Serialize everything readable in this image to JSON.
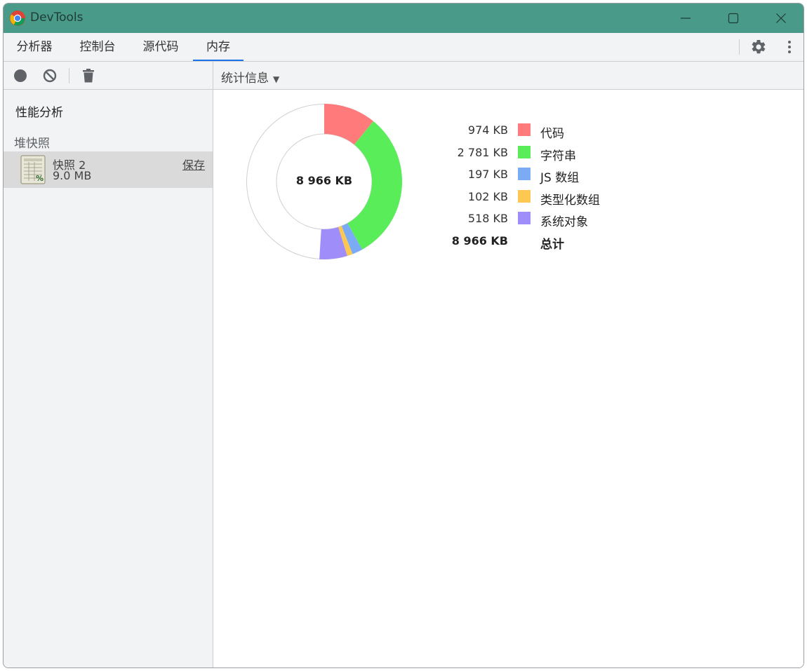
{
  "window": {
    "title": "DevTools"
  },
  "tabs": [
    {
      "label": "分析器"
    },
    {
      "label": "控制台"
    },
    {
      "label": "源代码"
    },
    {
      "label": "内存"
    }
  ],
  "sidebar": {
    "section_title": "性能分析",
    "group_title": "堆快照",
    "snapshot": {
      "name": "快照 2",
      "size": "9.0 MB",
      "save_label": "保存"
    }
  },
  "main": {
    "view_select": "统计信息",
    "center_total": "8 966 KB"
  },
  "colors": {
    "accent": "#1a73e8",
    "titlebar": "#4a9a89",
    "code": "#ff7a7a",
    "strings": "#59ee59",
    "js_arrays": "#7cabf5",
    "typed_arrays": "#fcc851",
    "system": "#9f8dfa"
  },
  "chart_data": {
    "type": "pie",
    "unit": "KB",
    "total": 8966,
    "series": [
      {
        "name": "代码",
        "value": 974,
        "value_label": "974 KB",
        "color": "#ff7a7a"
      },
      {
        "name": "字符串",
        "value": 2781,
        "value_label": "2 781 KB",
        "color": "#59ee59"
      },
      {
        "name": "JS 数组",
        "value": 197,
        "value_label": "197 KB",
        "color": "#7cabf5"
      },
      {
        "name": "类型化数组",
        "value": 102,
        "value_label": "102 KB",
        "color": "#fcc851"
      },
      {
        "name": "系统对象",
        "value": 518,
        "value_label": "518 KB",
        "color": "#9f8dfa"
      }
    ],
    "total_label": "总计",
    "total_value_label": "8 966 KB"
  }
}
